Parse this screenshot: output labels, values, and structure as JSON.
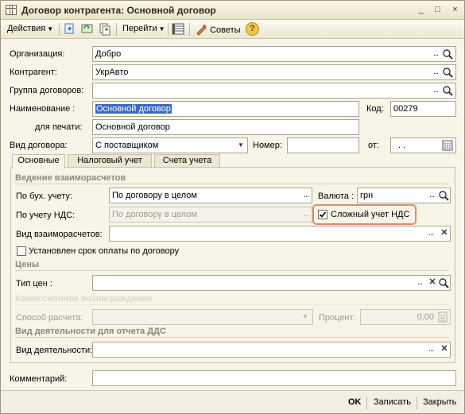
{
  "window": {
    "title": "Договор контрагента: Основной договор",
    "controls": [
      "_",
      "□",
      "×"
    ]
  },
  "toolbar": {
    "actions_label": "Действия",
    "goto_label": "Перейти",
    "tips_label": "Советы",
    "help_label": "?"
  },
  "form": {
    "organization_label": "Организация:",
    "organization_value": "Добро",
    "counterparty_label": "Контрагент:",
    "counterparty_value": "УкрАвто",
    "group_label": "Группа договоров:",
    "group_value": "",
    "name_label": "Наименование :",
    "name_value": "Основной договор",
    "code_label": "Код:",
    "code_value": "00279",
    "print_label": "для печати:",
    "print_value": "Основной договор",
    "type_label": "Вид договора:",
    "type_value": "С поставщиком",
    "number_label": "Номер:",
    "number_value": "",
    "from_label": "от:",
    "from_value": ". ."
  },
  "tabs": [
    "Основные",
    "Налоговый учет",
    "Счета учета"
  ],
  "main_tab": {
    "settlements_section": "Ведение взаиморасчетов",
    "accounting_label": "По бух. учету:",
    "accounting_value": "По договору в целом",
    "currency_label": "Валюта :",
    "currency_value": "грн",
    "vat_label": "По учету НДС:",
    "vat_value": "По договору в целом",
    "complex_vat_label": "Сложный учет НДС",
    "complex_vat_checked": true,
    "settlement_kind_label": "Вид взаиморасчетов:",
    "settlement_kind_value": "",
    "payment_term_label": "Установлен срок оплаты по договору",
    "payment_term_checked": false,
    "prices_section": "Цены",
    "price_type_label": "Тип цен :",
    "price_type_value": "",
    "commission_section": "Комиссионное вознаграждение",
    "calc_method_label": "Способ расчета:",
    "calc_method_value": "",
    "percent_label": "Процент:",
    "percent_value": "0,00",
    "activity_section": "Вид деятельности для отчета ДДС",
    "activity_label": "Вид деятельности:",
    "activity_value": ""
  },
  "comment_label": "Комментарий:",
  "comment_value": "",
  "footer": {
    "ok_label": "OK",
    "save_label": "Записать",
    "close_label": "Закрыть"
  }
}
